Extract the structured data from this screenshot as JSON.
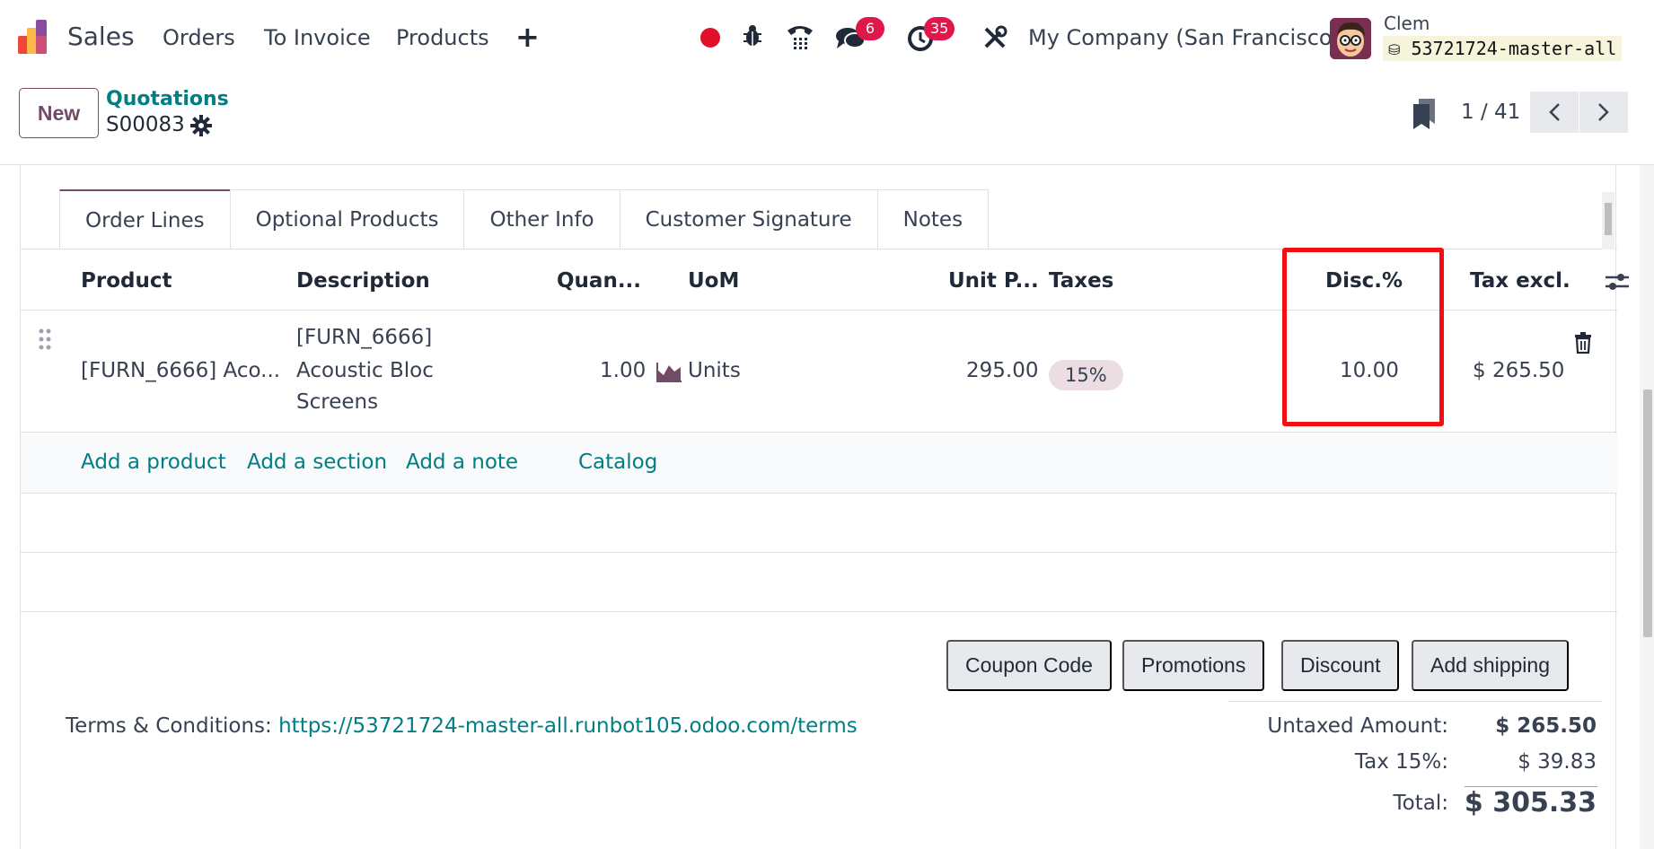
{
  "navbar": {
    "app_name": "Sales",
    "menu": [
      "Orders",
      "To Invoice",
      "Products"
    ],
    "plus_icon": "plus-icon",
    "messages_badge": "6",
    "activities_badge": "35",
    "company": "My Company (San Francisco)",
    "user_name": "Clem",
    "database": "53721724-master-all"
  },
  "control_panel": {
    "new_label": "New",
    "breadcrumb": "Quotations",
    "record_name": "S00083",
    "pager": "1 / 41"
  },
  "tabs": [
    "Order Lines",
    "Optional Products",
    "Other Info",
    "Customer Signature",
    "Notes"
  ],
  "table": {
    "columns": {
      "product": "Product",
      "description": "Description",
      "quantity": "Quan...",
      "uom": "UoM",
      "unit_price": "Unit P...",
      "taxes": "Taxes",
      "discount": "Disc.%",
      "subtotal": "Tax excl."
    },
    "rows": [
      {
        "product": "[FURN_6666] Aco...",
        "description_lines": [
          "[FURN_6666]",
          "Acoustic Bloc",
          "Screens"
        ],
        "quantity": "1.00",
        "uom": "Units",
        "unit_price": "295.00",
        "tax": "15%",
        "discount": "10.00",
        "subtotal": "$ 265.50"
      }
    ],
    "add_links": {
      "add_product": "Add a product",
      "add_section": "Add a section",
      "add_note": "Add a note",
      "catalog": "Catalog"
    }
  },
  "actions": [
    "Coupon Code",
    "Promotions",
    "Discount",
    "Add shipping"
  ],
  "terms": {
    "label": "Terms & Conditions:",
    "link": "https://53721724-master-all.runbot105.odoo.com/terms"
  },
  "totals": {
    "untaxed_label": "Untaxed Amount:",
    "untaxed_value": "$ 265.50",
    "tax_label": "Tax 15%:",
    "tax_value": "$ 39.83",
    "total_label": "Total:",
    "total_value": "$ 305.33"
  },
  "colors": {
    "brand": "#714b67",
    "link": "#017e84",
    "badge": "#e0174a",
    "highlight": "#f20e14"
  }
}
